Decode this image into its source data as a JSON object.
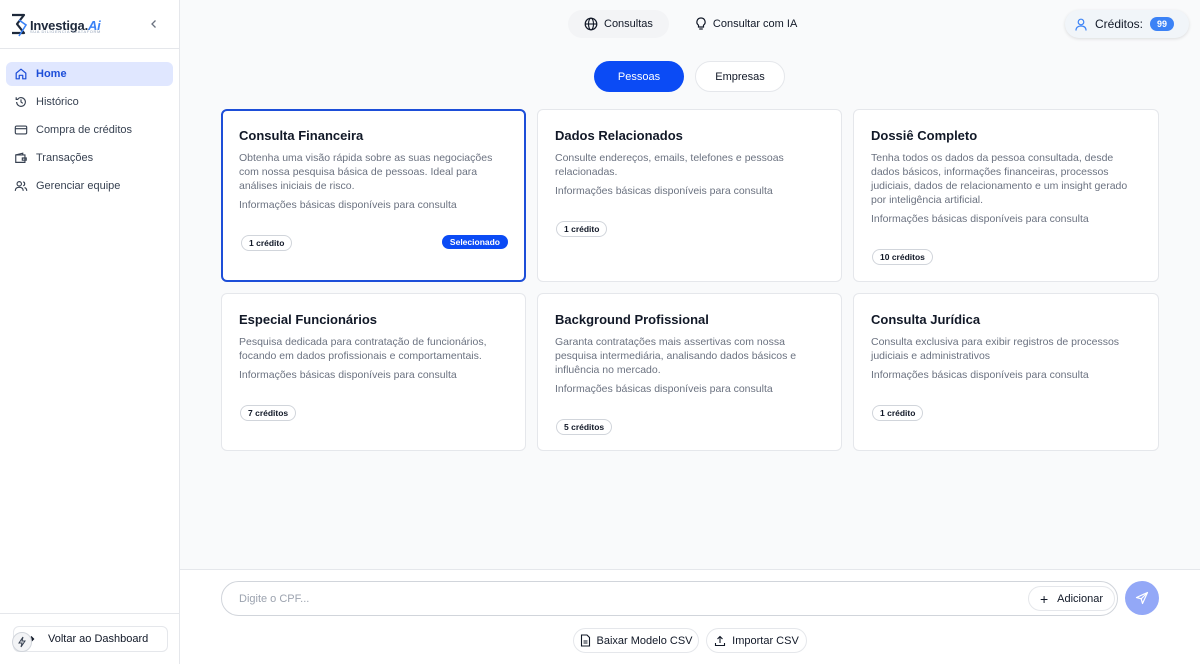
{
  "brand": {
    "name": "Investiga",
    "name_accent": "Ai",
    "tagline": "SUA DILIGENCIA PLATAFORM"
  },
  "sidebar": {
    "items": [
      {
        "label": "Home",
        "icon": "home-icon",
        "active": true
      },
      {
        "label": "Histórico",
        "icon": "history-icon"
      },
      {
        "label": "Compra de créditos",
        "icon": "credit-card-icon"
      },
      {
        "label": "Transações",
        "icon": "wallet-icon"
      },
      {
        "label": "Gerenciar equipe",
        "icon": "users-icon"
      }
    ],
    "back_label": "Voltar ao Dashboard"
  },
  "topnav": {
    "consultas": "Consultas",
    "consultar_ia": "Consultar com IA"
  },
  "credits": {
    "label": "Créditos:",
    "count": "99"
  },
  "segment": {
    "pessoas": "Pessoas",
    "empresas": "Empresas",
    "selected": "Pessoas"
  },
  "cards": [
    {
      "title": "Consulta Financeira",
      "desc": "Obtenha uma visão rápida sobre as suas negociações com nossa pesquisa básica de pessoas. Ideal para análises iniciais de risco.",
      "info": "Informações básicas disponíveis para consulta",
      "credits": "1 crédito",
      "selected_label": "Selecionado"
    },
    {
      "title": "Dados Relacionados",
      "desc": "Consulte endereços, emails, telefones e pessoas relacionadas.",
      "info": "Informações básicas disponíveis para consulta",
      "credits": "1 crédito"
    },
    {
      "title": "Dossiê Completo",
      "desc": "Tenha todos os dados da pessoa consultada, desde dados básicos, informações financeiras, processos judiciais, dados de relacionamento e um insight gerado por inteligência artificial.",
      "info": "Informações básicas disponíveis para consulta",
      "credits": "10 créditos"
    },
    {
      "title": "Especial Funcionários",
      "desc": "Pesquisa dedicada para contratação de funcionários, focando em dados profissionais e comportamentais.",
      "info": "Informações básicas disponíveis para consulta",
      "credits": "7 créditos"
    },
    {
      "title": "Background Profissional",
      "desc": "Garanta contratações mais assertivas com nossa pesquisa intermediária, analisando dados básicos e influência no mercado.",
      "info": "Informações básicas disponíveis para consulta",
      "credits": "5 créditos"
    },
    {
      "title": "Consulta Jurídica",
      "desc": "Consulta exclusiva para exibir registros de processos judiciais e administrativos",
      "info": "Informações básicas disponíveis para consulta",
      "credits": "1 crédito"
    }
  ],
  "search": {
    "placeholder": "Digite o CPF...",
    "value": "",
    "add_label": "Adicionar"
  },
  "csv": {
    "download_label": "Baixar Modelo CSV",
    "import_label": "Importar CSV"
  },
  "colors": {
    "primary": "#0b4bf5",
    "active_nav_bg": "#e0e7ff",
    "send_button": "#93a8f7"
  }
}
